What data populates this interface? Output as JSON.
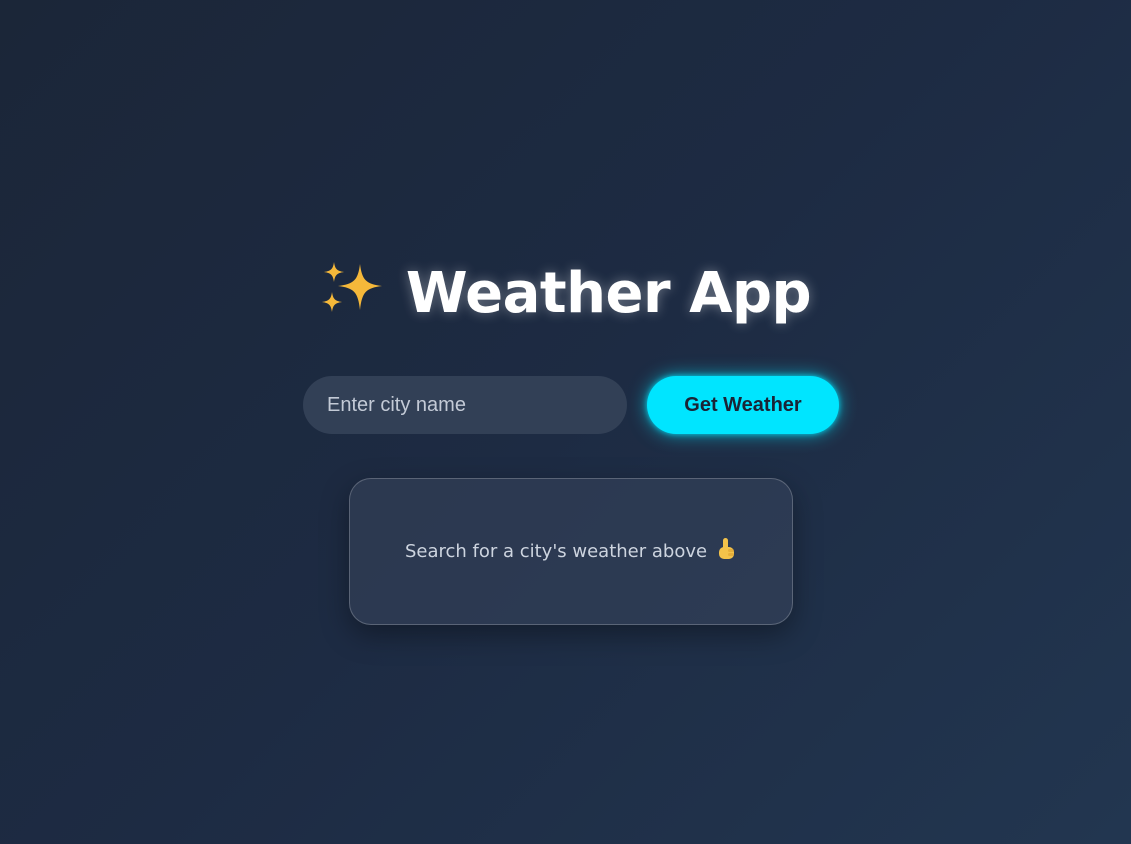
{
  "header": {
    "title": "Weather App",
    "icon": "sparkles-icon",
    "icon_color": "#f5b83a"
  },
  "search": {
    "placeholder": "Enter city name",
    "value": "",
    "button_label": "Get Weather",
    "button_color": "#00e5ff"
  },
  "result": {
    "message": "Search for a city's weather above",
    "icon": "pointing-up-hand-icon"
  }
}
